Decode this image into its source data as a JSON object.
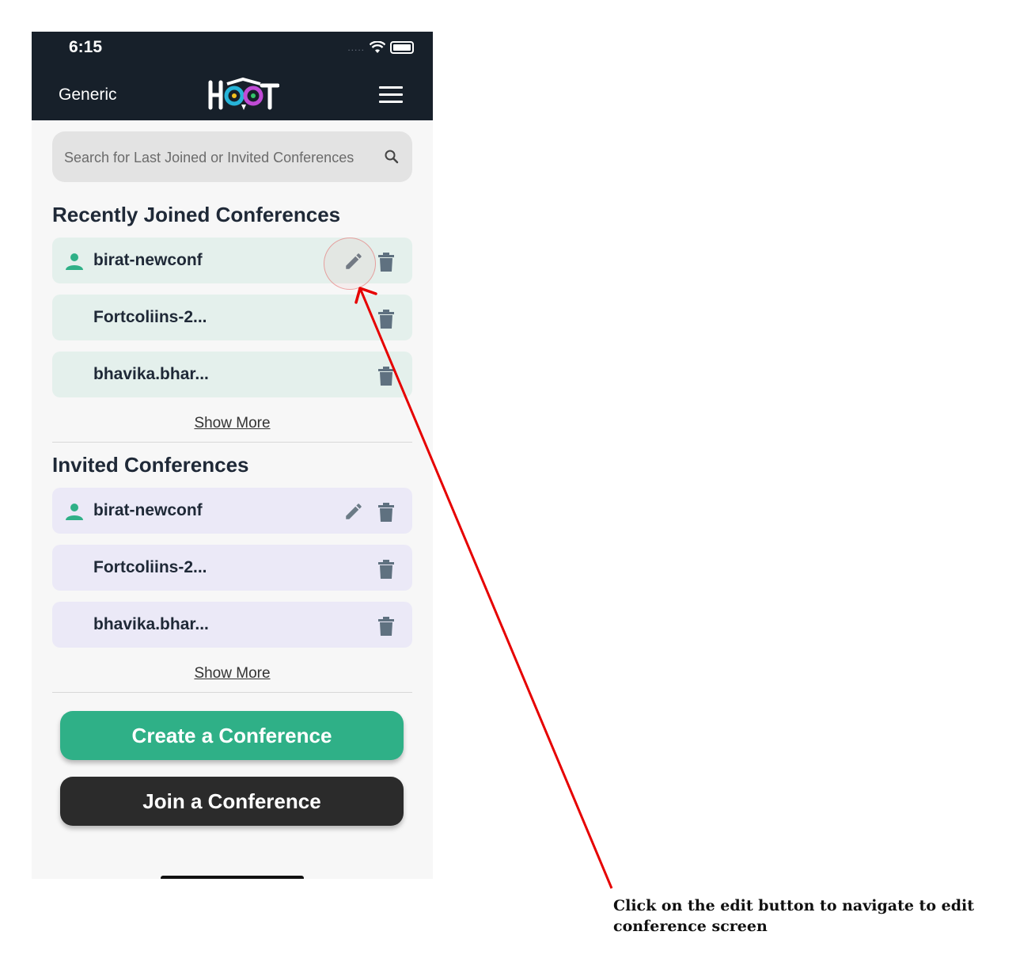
{
  "status_bar": {
    "time": "6:15",
    "signal": "....."
  },
  "header": {
    "context_label": "Generic",
    "logo_text": "HOOT",
    "menu_icon": "hamburger-menu-icon"
  },
  "search": {
    "placeholder": "Search for Last Joined or Invited Conferences",
    "icon": "search-icon"
  },
  "recently_joined": {
    "title": "Recently Joined Conferences",
    "items": [
      {
        "name": "birat-newconf",
        "owner_icon": true,
        "editable": true
      },
      {
        "name": "Fortcoliins-2...",
        "owner_icon": false,
        "editable": false
      },
      {
        "name": "bhavika.bhar...",
        "owner_icon": false,
        "editable": false
      }
    ],
    "show_more": "Show More"
  },
  "invited": {
    "title": "Invited Conferences",
    "items": [
      {
        "name": "birat-newconf",
        "owner_icon": true,
        "editable": true
      },
      {
        "name": "Fortcoliins-2...",
        "owner_icon": false,
        "editable": false
      },
      {
        "name": "bhavika.bhar...",
        "owner_icon": false,
        "editable": false
      }
    ],
    "show_more": "Show More"
  },
  "actions": {
    "create": "Create a Conference",
    "join": "Join a Conference"
  },
  "annotation": {
    "text": "Click on the edit button to navigate to edit conference screen"
  },
  "colors": {
    "accent_green": "#2fb087",
    "header_bg": "#17202a",
    "annotation_red": "#e60000",
    "joined_row": "#e4f0ec",
    "invited_row": "#ebe9f7"
  }
}
